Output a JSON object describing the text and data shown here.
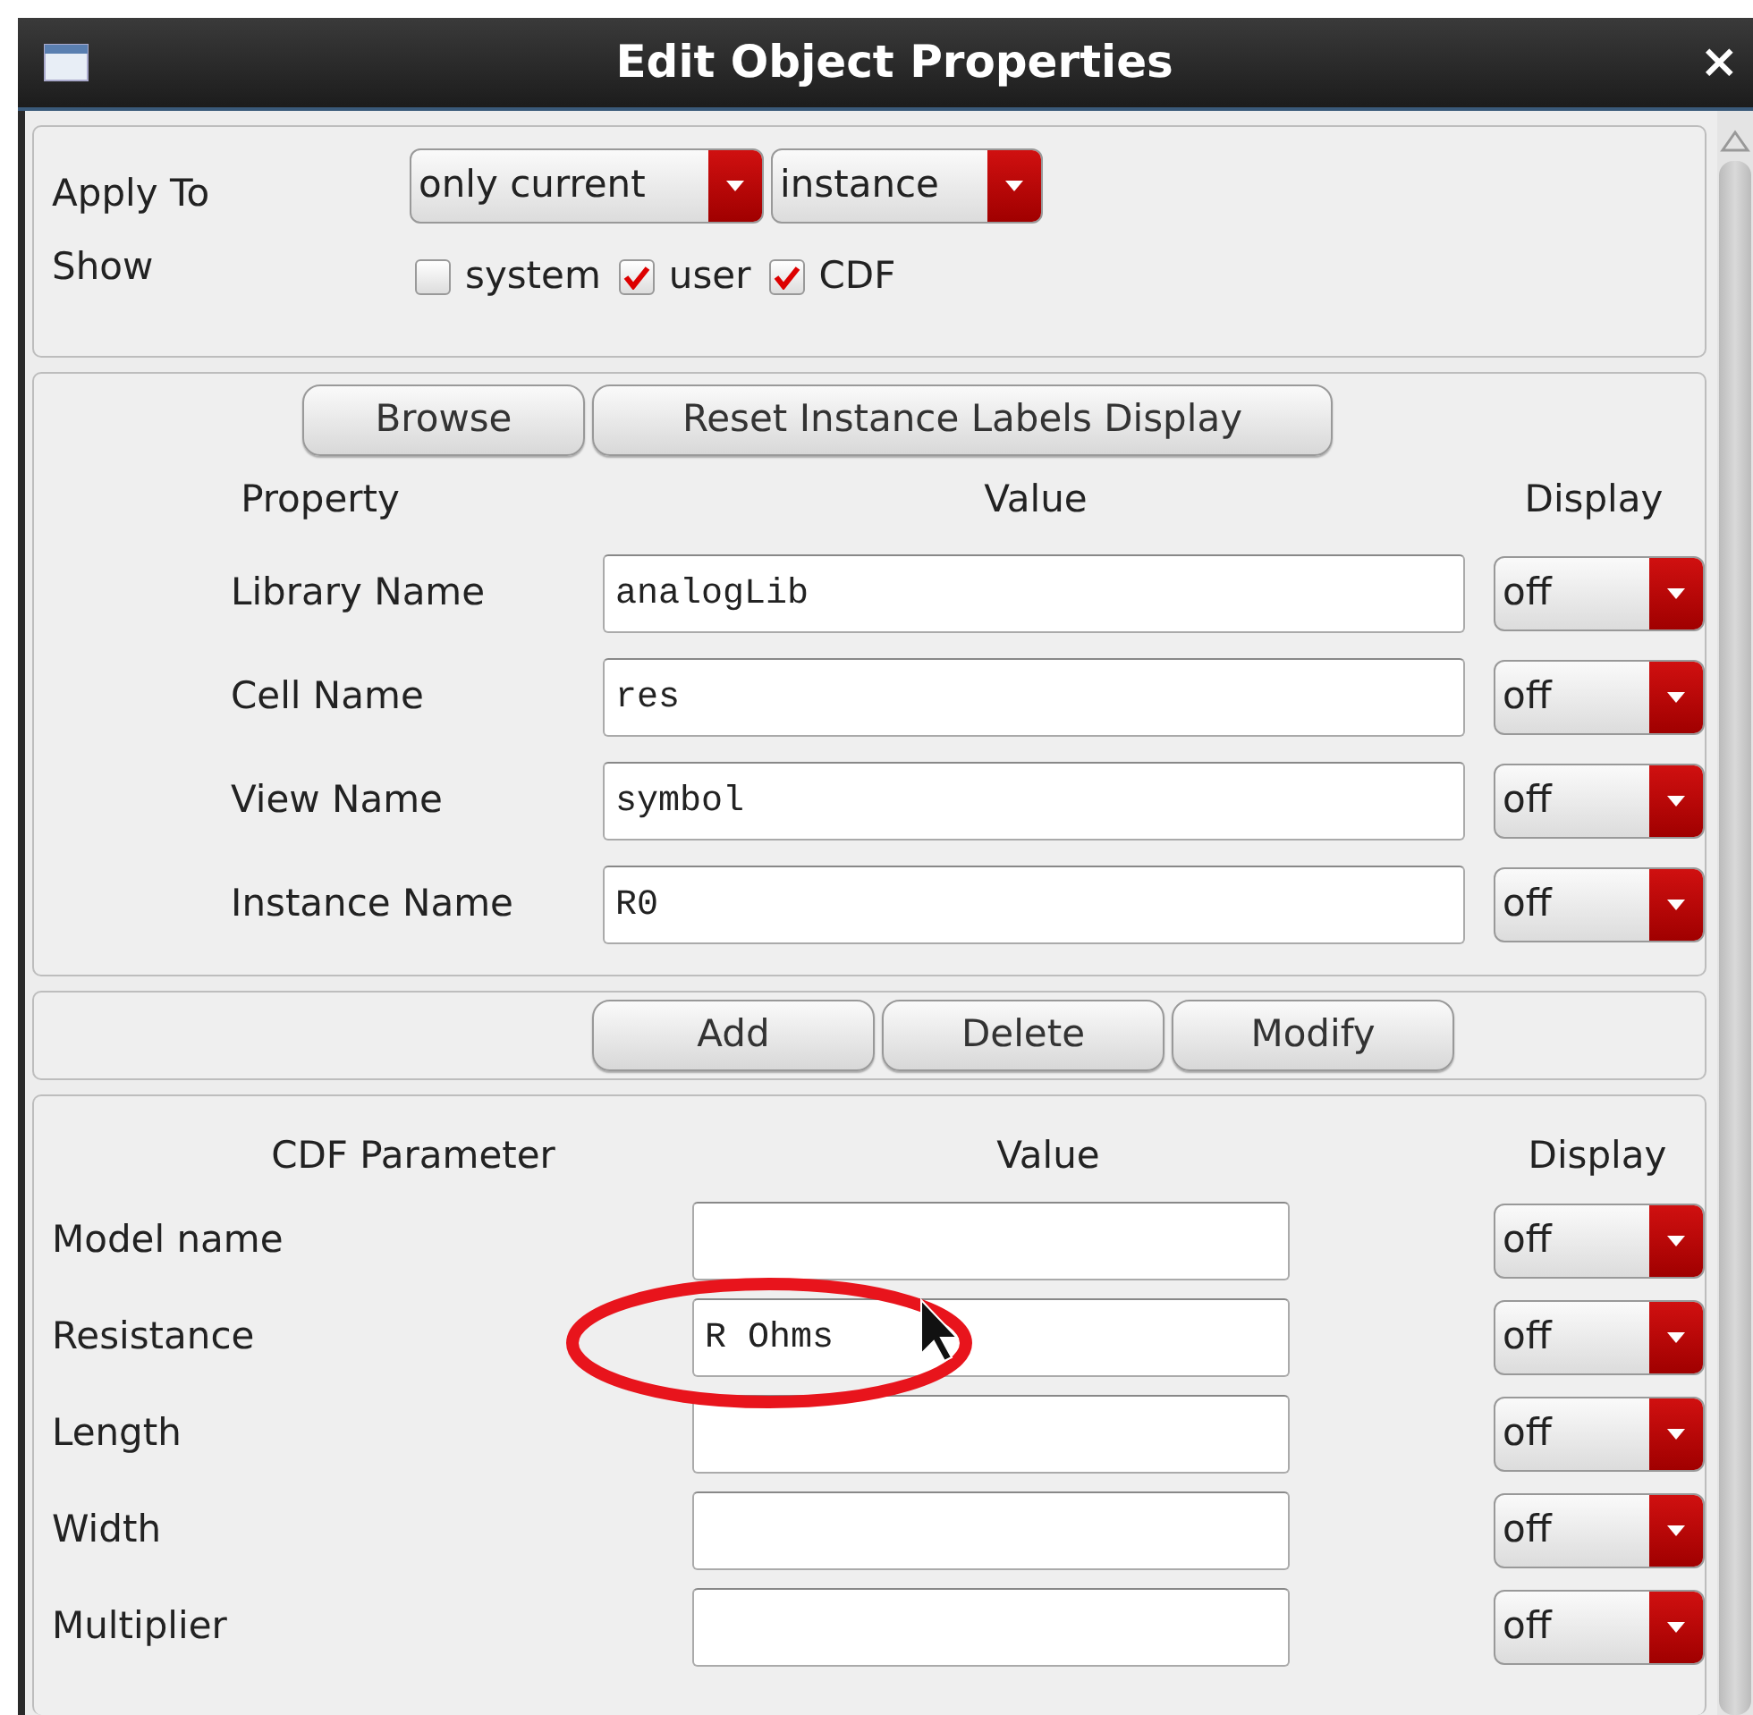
{
  "window": {
    "title": "Edit Object Properties",
    "close": "×"
  },
  "apply_to": {
    "label": "Apply To",
    "dropdowns": [
      {
        "value": "only current"
      },
      {
        "value": "instance"
      }
    ]
  },
  "show": {
    "label": "Show",
    "options": [
      {
        "label": "system",
        "checked": false
      },
      {
        "label": "user",
        "checked": true
      },
      {
        "label": "CDF",
        "checked": true
      }
    ]
  },
  "top_buttons": [
    "Browse",
    "Reset Instance Labels Display"
  ],
  "properties": {
    "columns": [
      "Property",
      "Value",
      "Display"
    ],
    "rows": [
      {
        "name": "Library Name",
        "value": "analogLib",
        "display": "off"
      },
      {
        "name": "Cell Name",
        "value": "res",
        "display": "off"
      },
      {
        "name": "View Name",
        "value": "symbol",
        "display": "off"
      },
      {
        "name": "Instance Name",
        "value": "R0",
        "display": "off"
      }
    ]
  },
  "edit_buttons": [
    "Add",
    "Delete",
    "Modify"
  ],
  "cdf": {
    "columns": [
      "CDF Parameter",
      "Value",
      "Display"
    ],
    "rows": [
      {
        "name": "Model name",
        "value": "",
        "display": "off",
        "circled": false
      },
      {
        "name": "Resistance",
        "value": "R Ohms",
        "display": "off",
        "circled": true
      },
      {
        "name": "Length",
        "value": "",
        "display": "off",
        "circled": false
      },
      {
        "name": "Width",
        "value": "",
        "display": "off",
        "circled": false
      },
      {
        "name": "Multiplier",
        "value": "",
        "display": "off",
        "circled": false
      }
    ]
  }
}
